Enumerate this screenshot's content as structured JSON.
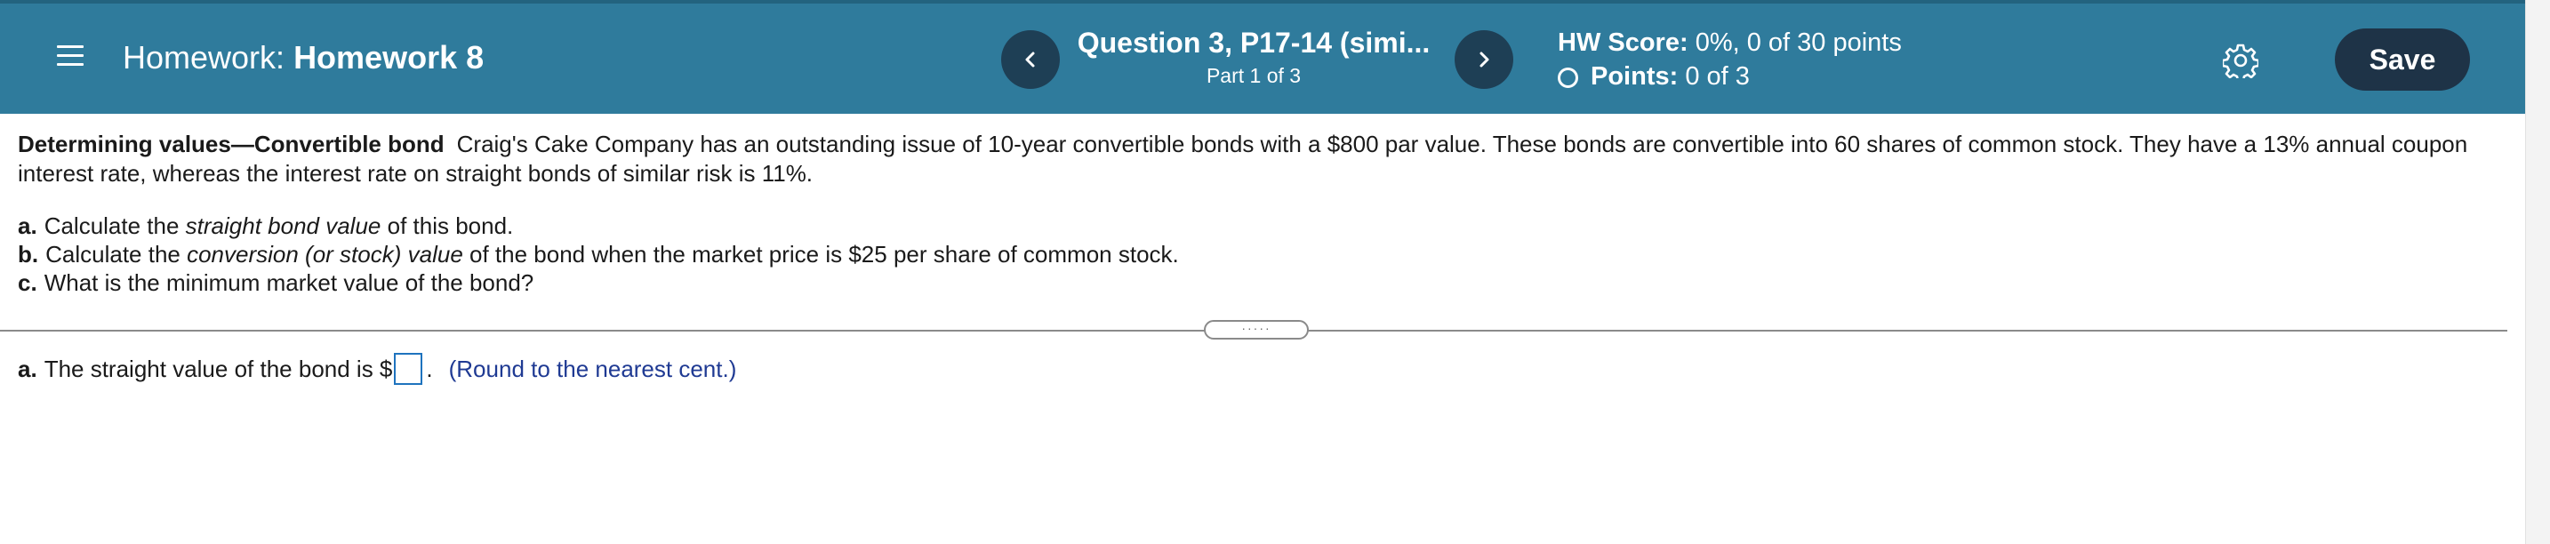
{
  "header": {
    "assignment_prefix": "Homework:",
    "assignment_name": "Homework 8",
    "question_title": "Question 3, P17-14 (simi...",
    "question_part": "Part 1 of 3",
    "hw_score_label": "HW Score:",
    "hw_score_value": "0%, 0 of 30 points",
    "points_label": "Points:",
    "points_value": "0 of 3",
    "save_label": "Save",
    "icons": [
      "menu-icon",
      "chevron-left-icon",
      "chevron-right-icon",
      "circle-icon",
      "gear-icon"
    ],
    "colors": {
      "bar": "#2f7b9c",
      "nav_button": "#1e3f55",
      "save_button": "#1e3347",
      "hint_text": "#1f3a93"
    }
  },
  "problem": {
    "lead": "Determining values—Convertible bond",
    "text": "Craig's Cake Company has an outstanding issue of 10-year convertible bonds with a $800 par value.  These bonds are convertible into 60 shares of common stock.  They have a 13% annual coupon interest rate, whereas the interest rate on straight bonds of similar risk is 11%.",
    "parts": [
      {
        "letter": "a.",
        "before": "Calculate the ",
        "emph": "straight bond value",
        "after": " of this bond."
      },
      {
        "letter": "b.",
        "before": "Calculate the ",
        "emph": "conversion (or stock) value",
        "after": " of the bond when the market price is $25 per share of common stock."
      },
      {
        "letter": "c.",
        "before": "What is the minimum market value of the bond?",
        "emph": "",
        "after": ""
      }
    ]
  },
  "answer": {
    "letter": "a.",
    "prefix": "The straight value of the bond is $",
    "input_value": "",
    "suffix": ".",
    "hint": "(Round to the nearest cent.)"
  }
}
